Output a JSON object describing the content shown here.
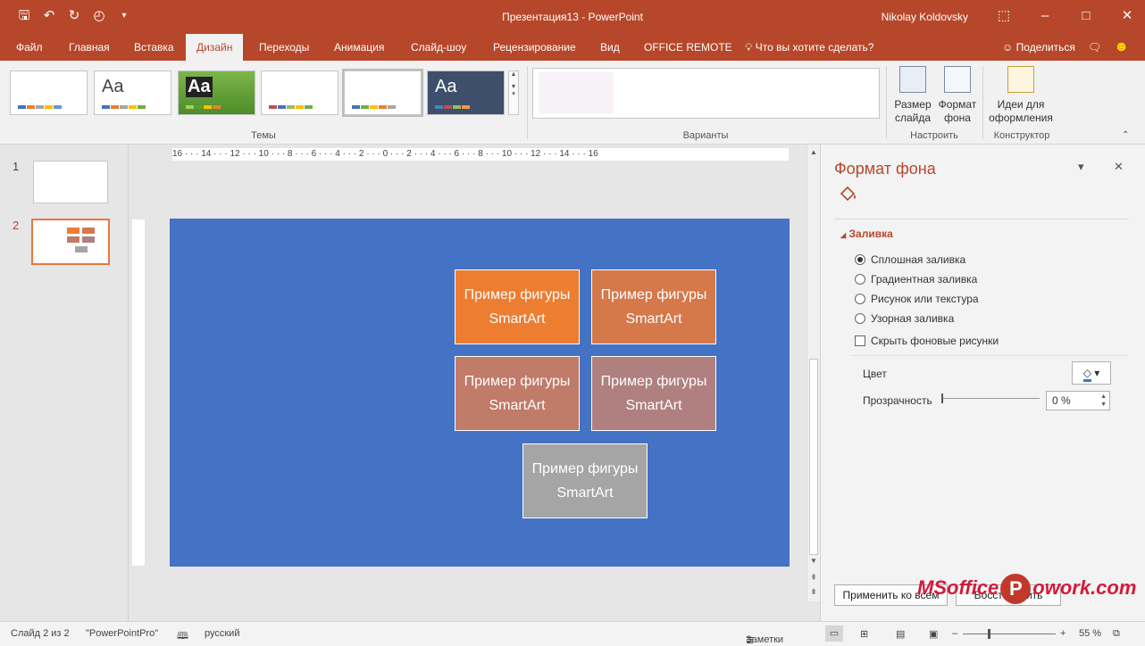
{
  "window": {
    "title": "Презентация13  -  PowerPoint",
    "user": "Nikolay Koldovsky"
  },
  "tabs": [
    {
      "label": "Файл"
    },
    {
      "label": "Главная"
    },
    {
      "label": "Вставка"
    },
    {
      "label": "Дизайн",
      "active": true
    },
    {
      "label": "Переходы"
    },
    {
      "label": "Анимация"
    },
    {
      "label": "Слайд-шоу"
    },
    {
      "label": "Рецензирование"
    },
    {
      "label": "Вид"
    },
    {
      "label": "OFFICE REMOTE"
    }
  ],
  "tellme": "Что вы хотите сделать?",
  "share": "Поделиться",
  "ribbon": {
    "themes_label": "Темы",
    "variants_label": "Варианты",
    "customize_label": "Настроить",
    "designer_label": "Конструктор",
    "slide_size": "Размер слайда",
    "format_bg": "Формат фона",
    "design_ideas": "Идеи для оформления",
    "theme_text": "Aa"
  },
  "slides": {
    "thumbs": [
      "1",
      "2"
    ],
    "selected": 2
  },
  "ruler": {
    "marks": "16 · · · 14 · · · 12 · · · 10 · · · 8 · · · 6 · · · 4 · · · 2 · · · 0 · · · 2 · · · 4 · · · 6 · · · 8 · · · 10 · · · 12 · · · 14 · · · 16"
  },
  "slide_shapes": [
    {
      "text": "Пример фигуры SmartArt",
      "color": "#ed7d31"
    },
    {
      "text": "Пример фигуры SmartArt",
      "color": "#d5784a"
    },
    {
      "text": "Пример фигуры SmartArt",
      "color": "#c07b69"
    },
    {
      "text": "Пример фигуры SmartArt",
      "color": "#b08080"
    },
    {
      "text": "Пример фигуры SmartArt",
      "color": "#a5a5a5"
    }
  ],
  "slide_background": "#4472c4",
  "format_pane": {
    "title": "Формат фона",
    "section": "Заливка",
    "options": [
      {
        "label": "Сплошная заливка",
        "checked": true
      },
      {
        "label": "Градиентная заливка",
        "checked": false
      },
      {
        "label": "Рисунок или текстура",
        "checked": false
      },
      {
        "label": "Узорная заливка",
        "checked": false
      }
    ],
    "hide_bg": "Скрыть фоновые рисунки",
    "color_label": "Цвет",
    "transparency_label": "Прозрачность",
    "transparency_value": "0 %",
    "apply_all": "Применить ко всем",
    "reset": "Восстановить"
  },
  "status": {
    "slide": "Слайд 2 из 2",
    "theme": "\"PowerPointPro\"",
    "language": "русский",
    "notes": "Заметки",
    "zoom": "55 %"
  },
  "watermark": {
    "left": "MSoffice",
    "p": "P",
    "right": "owork.com"
  }
}
